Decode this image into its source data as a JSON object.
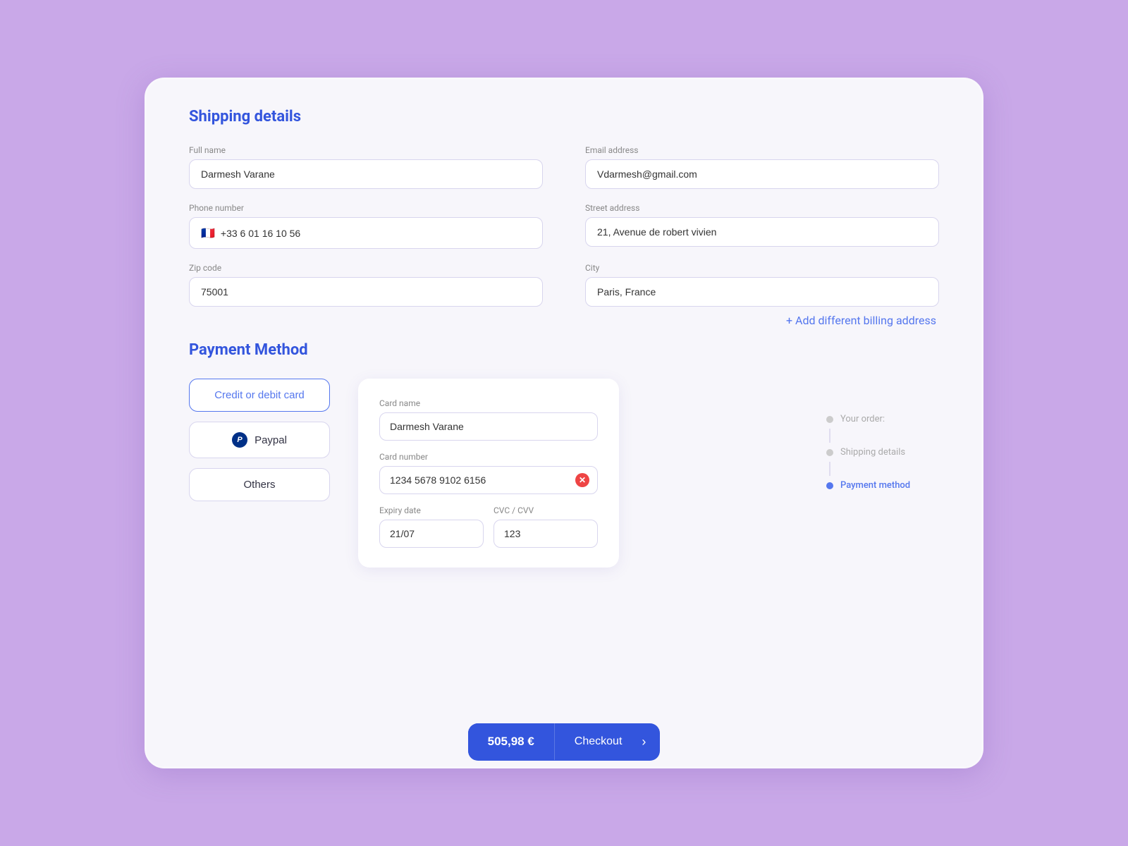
{
  "app": {
    "background_color": "#c9a8e8",
    "frame_color": "#f0eef8"
  },
  "shipping": {
    "section_title": "Shipping details",
    "full_name_label": "Full name",
    "full_name_value": "Darmesh Varane",
    "email_label": "Email address",
    "email_value": "Vdarmesh@gmail.com",
    "phone_label": "Phone number",
    "phone_flag": "🇫🇷",
    "phone_value": "+33 6 01 16 10 56",
    "street_label": "Street address",
    "street_value": "21, Avenue de robert vivien",
    "zip_label": "Zip code",
    "zip_value": "75001",
    "city_label": "City",
    "city_value": "Paris, France",
    "add_billing_label": "+ Add different billing address"
  },
  "payment": {
    "section_title": "Payment Method",
    "methods": [
      {
        "id": "card",
        "label": "Credit or debit card",
        "active": true
      },
      {
        "id": "paypal",
        "label": "Paypal",
        "active": false
      },
      {
        "id": "others",
        "label": "Others",
        "active": false
      }
    ],
    "card_form": {
      "card_name_label": "Card name",
      "card_name_value": "Darmesh Varane",
      "card_number_label": "Card number",
      "card_number_value": "1234 5678 9102 6156",
      "expiry_label": "Expiry date",
      "expiry_value": "21/07",
      "cvc_label": "CVC / CVV",
      "cvc_value": "123"
    }
  },
  "sidebar": {
    "steps": [
      {
        "label": "Your order:",
        "state": "inactive"
      },
      {
        "label": "Shipping details",
        "state": "inactive"
      },
      {
        "label": "Payment method",
        "state": "active"
      }
    ]
  },
  "checkout": {
    "price": "505,98 €",
    "button_label": "Checkout",
    "arrow": "›"
  }
}
